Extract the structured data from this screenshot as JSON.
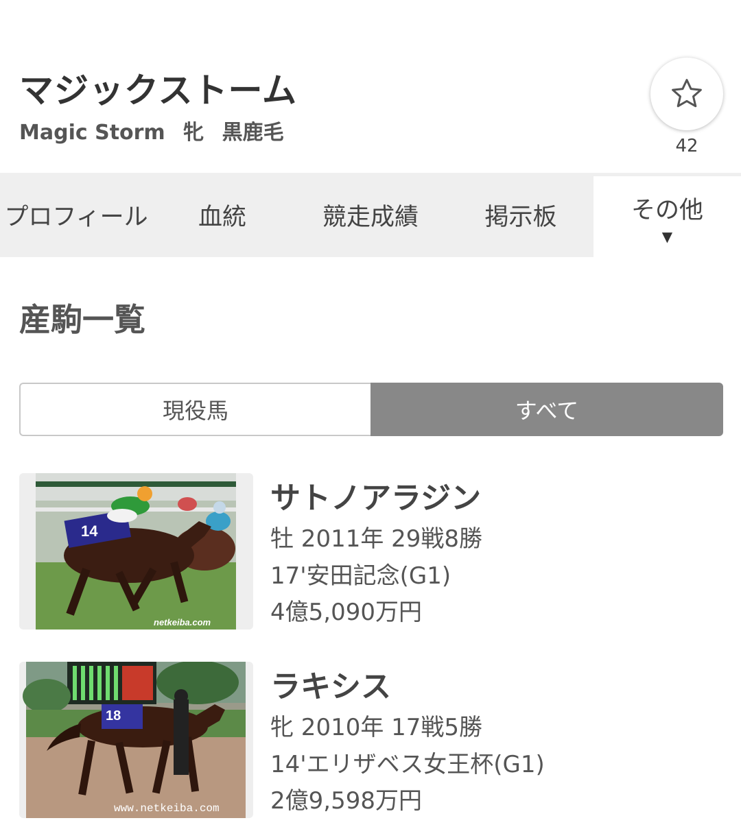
{
  "header": {
    "title": "マジックストーム",
    "name_en": "Magic Storm",
    "sex": "牝",
    "color": "黒鹿毛",
    "favorite_count": "42",
    "favorite_icon": "star-outline-icon"
  },
  "tabs": [
    {
      "label": "プロフィール"
    },
    {
      "label": "血統"
    },
    {
      "label": "競走成績"
    },
    {
      "label": "掲示板"
    },
    {
      "label": "その他",
      "active": true,
      "caret": "▼"
    }
  ],
  "section": {
    "title": "産駒一覧"
  },
  "filter": {
    "options": [
      "現役馬",
      "すべて"
    ],
    "selected": "すべて"
  },
  "offspring": [
    {
      "name": "サトノアラジン",
      "info": "牡 2011年 29戦8勝",
      "best_race": "17'安田記念(G1)",
      "earnings": "4億5,090万円",
      "photo_watermark": "netkeiba.com",
      "saddle_number": "14"
    },
    {
      "name": "ラキシス",
      "info": "牝 2010年 17戦5勝",
      "best_race": "14'エリザベス女王杯(G1)",
      "earnings": "2億9,598万円",
      "photo_watermark": "www.netkeiba.com",
      "saddle_number": "18"
    }
  ]
}
